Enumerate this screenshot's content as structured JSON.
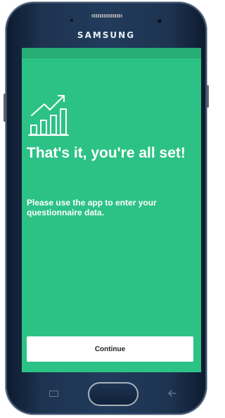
{
  "device": {
    "brand": "SAMSUNG"
  },
  "screen": {
    "background_color": "#2dc285",
    "icon": "chart-trend-icon",
    "title": "That's it, you're all set!",
    "subtitle": "Please use the app to enter your questionnaire data.",
    "continue_label": "Continue"
  },
  "navigation": {
    "recent_icon": "recent-apps-icon",
    "home": "home-button",
    "back_icon": "back-icon"
  }
}
